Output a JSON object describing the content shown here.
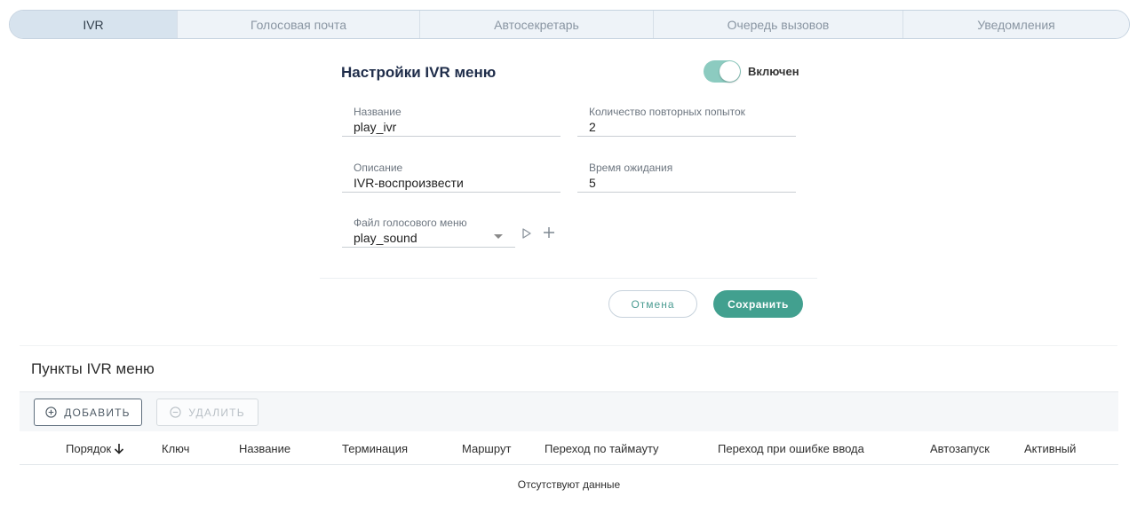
{
  "tabs": [
    {
      "label": "IVR",
      "active": true
    },
    {
      "label": "Голосовая почта",
      "active": false
    },
    {
      "label": "Автосекретарь",
      "active": false
    },
    {
      "label": "Очередь вызовов",
      "active": false
    },
    {
      "label": "Уведомления",
      "active": false
    }
  ],
  "settings": {
    "title": "Настройки IVR меню",
    "toggle_label": "Включен",
    "enabled": true,
    "name": {
      "label": "Название",
      "value": "play_ivr"
    },
    "retries": {
      "label": "Количество повторных попыток",
      "value": "2"
    },
    "description": {
      "label": "Описание",
      "value": "IVR-воспроизвести"
    },
    "timeout": {
      "label": "Время ожидания",
      "value": "5"
    },
    "voice_file": {
      "label": "Файл голосового меню",
      "value": "play_sound"
    }
  },
  "actions": {
    "cancel_label": "Отмена",
    "save_label": "Сохранить"
  },
  "menu_items": {
    "title": "Пункты IVR меню",
    "add_label": "ДОБАВИТЬ",
    "delete_label": "УДАЛИТЬ",
    "columns": [
      "Порядок",
      "Ключ",
      "Название",
      "Терминация",
      "Маршрут",
      "Переход по таймауту",
      "Переход при ошибке ввода",
      "Автозапуск",
      "Активный"
    ],
    "empty_text": "Отсутствуют данные"
  },
  "colors": {
    "accent": "#42a08f",
    "toggle_track": "#8ccbc0",
    "title": "#1f2d4a"
  }
}
